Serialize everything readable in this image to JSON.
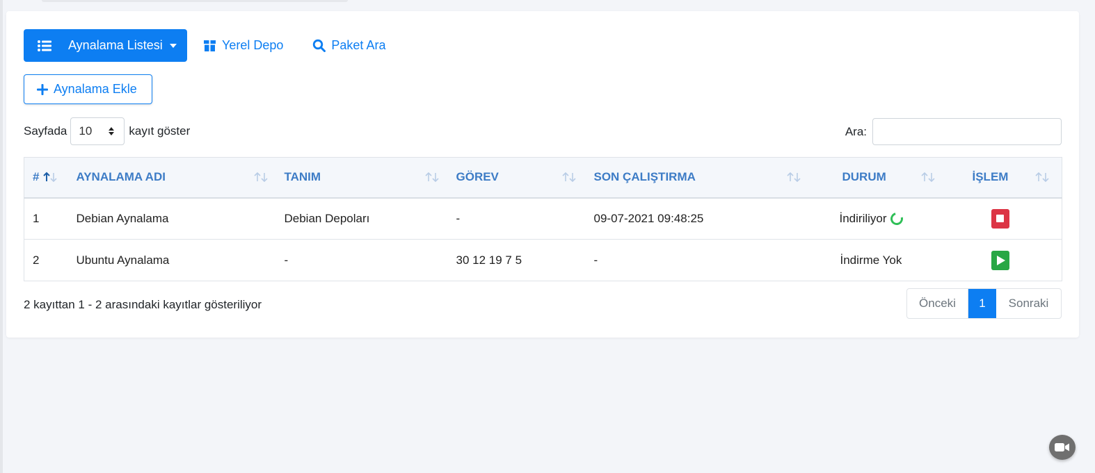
{
  "nav": {
    "mirror_list_label": "Aynalama Listesi",
    "local_repo_label": "Yerel Depo",
    "package_search_label": "Paket Ara"
  },
  "add_mirror_label": "Aynalama Ekle",
  "length_control": {
    "prefix": "Sayfada",
    "value": "10",
    "suffix": "kayıt göster"
  },
  "search": {
    "label": "Ara:",
    "value": ""
  },
  "table": {
    "columns": [
      "#",
      "AYNALAMA ADI",
      "TANIM",
      "GÖREV",
      "SON ÇALIŞTIRMA",
      "DURUM",
      "İŞLEM"
    ],
    "rows": [
      {
        "id": "1",
        "name": "Debian Aynalama",
        "description": "Debian Depoları",
        "task": "-",
        "last_run": "09-07-2021 09:48:25",
        "status": "İndiriliyor",
        "action": "stop"
      },
      {
        "id": "2",
        "name": "Ubuntu Aynalama",
        "description": "-",
        "task": "30 12 19 7 5",
        "last_run": "-",
        "status": "İndirme Yok",
        "action": "play"
      }
    ]
  },
  "info_text": "2 kayıttan 1 - 2 arasındaki kayıtlar gösteriliyor",
  "pagination": {
    "prev": "Önceki",
    "current": "1",
    "next": "Sonraki"
  },
  "colors": {
    "primary": "#0d7ef2",
    "danger": "#dc3545",
    "success": "#28a745",
    "header_text": "#3d7cc6"
  },
  "icons": [
    "list-icon",
    "caret-down-icon",
    "box-icon",
    "search-icon",
    "plus-icon",
    "sort-icon",
    "spinner-icon",
    "stop-icon",
    "play-icon",
    "video-camera-icon"
  ]
}
